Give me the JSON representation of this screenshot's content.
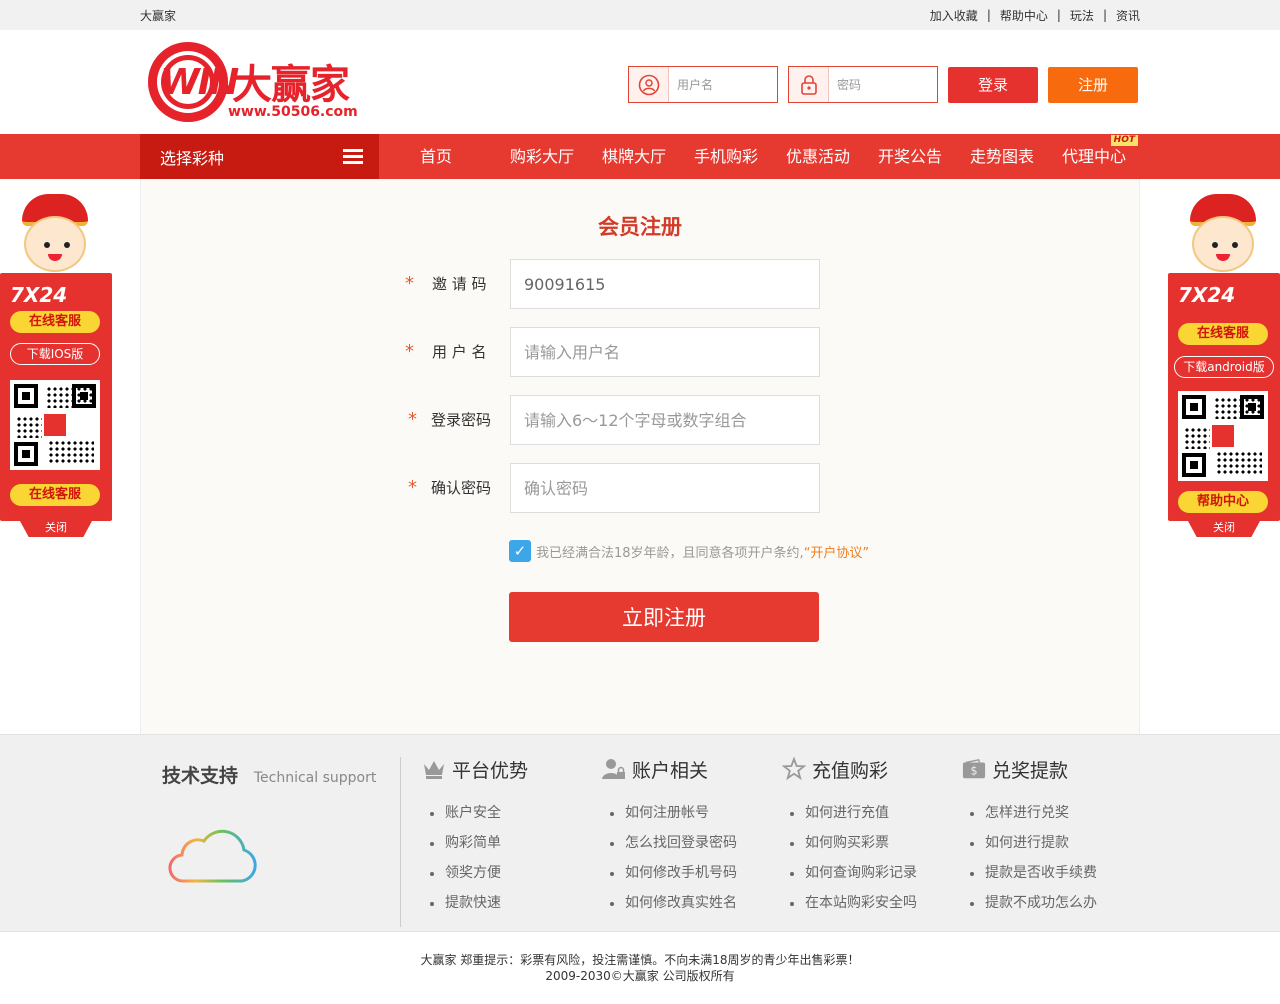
{
  "topbar": {
    "site_name": "大赢家",
    "links": [
      "加入收藏",
      "帮助中心",
      "玩法",
      "资讯"
    ],
    "separator": "|"
  },
  "header": {
    "logo": {
      "mark": "WIN",
      "name": "大赢家",
      "url": "www.50506.com"
    },
    "username_placeholder": "用户名",
    "password_placeholder": "密码",
    "login_label": "登录",
    "register_label": "注册"
  },
  "nav": {
    "select_label": "选择彩种",
    "items": [
      "首页",
      "购彩大厅",
      "棋牌大厅",
      "手机购彩",
      "优惠活动",
      "开奖公告",
      "走势图表",
      "代理中心"
    ],
    "hot_badge": "HOT"
  },
  "form": {
    "title": "会员注册",
    "required_mark": "*",
    "fields": [
      {
        "label": "邀 请 码",
        "value": "90091615",
        "placeholder": ""
      },
      {
        "label": "用 户 名",
        "value": "",
        "placeholder": "请输入用户名"
      },
      {
        "label": "登录密码",
        "value": "",
        "placeholder": "请输入6～12个字母或数字组合"
      },
      {
        "label": "确认密码",
        "value": "",
        "placeholder": "确认密码"
      }
    ],
    "agree_checked": true,
    "agree_text": "我已经满合法18岁年龄，且同意各项开户条约,",
    "agree_link": "“开户协议”",
    "submit_label": "立即注册"
  },
  "footer": {
    "tech_title": "技术支持",
    "tech_subtitle": "Technical support",
    "columns": [
      {
        "title": "平台优势",
        "icon": "crown-icon",
        "items": [
          "账户安全",
          "购彩简单",
          "领奖方便",
          "提款快速"
        ]
      },
      {
        "title": "账户相关",
        "icon": "user-lock-icon",
        "items": [
          "如何注册帐号",
          "怎么找回登录密码",
          "如何修改手机号码",
          "如何修改真实姓名"
        ]
      },
      {
        "title": "充值购彩",
        "icon": "star-icon",
        "items": [
          "如何进行充值",
          "如何购买彩票",
          "如何查询购彩记录",
          "在本站购彩安全吗"
        ]
      },
      {
        "title": "兑奖提款",
        "icon": "wallet-icon",
        "items": [
          "怎样进行兑奖",
          "如何进行提款",
          "提款是否收手续费",
          "提款不成功怎么办"
        ]
      }
    ],
    "notice": "大赢家 郑重提示：彩票有风险，投注需谨慎。不向未满18周岁的青少年出售彩票！",
    "copyright": "2009-2030©大赢家 公司版权所有"
  },
  "float_left": {
    "brand": "7X24",
    "service_top": "在线客服",
    "download": "下载IOS版",
    "service_bottom": "在线客服",
    "close": "关闭"
  },
  "float_right": {
    "brand": "7X24",
    "service_top": "在线客服",
    "download": "下载android版",
    "service_bottom": "帮助中心",
    "close": "关闭"
  },
  "colors": {
    "brand_red": "#e6392f",
    "nav_dark_red": "#c71b12",
    "register_orange": "#f76b0e",
    "title_red": "#d33b29",
    "checkbox_blue": "#3ba6e8",
    "link_orange": "#f17d1b"
  }
}
